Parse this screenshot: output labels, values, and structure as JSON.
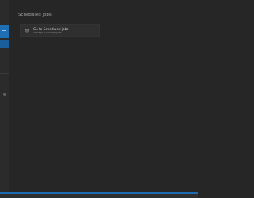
{
  "colors": {
    "background": "#262626",
    "accent": "#1f6fb5",
    "card": "#2f2f2f"
  },
  "main": {
    "section_title": "Scheduled jobs",
    "cards": [
      {
        "icon": "settings-icon",
        "title": "Go to Scheduled jobs",
        "subtitle": "Manage scheduled jobs"
      }
    ]
  }
}
